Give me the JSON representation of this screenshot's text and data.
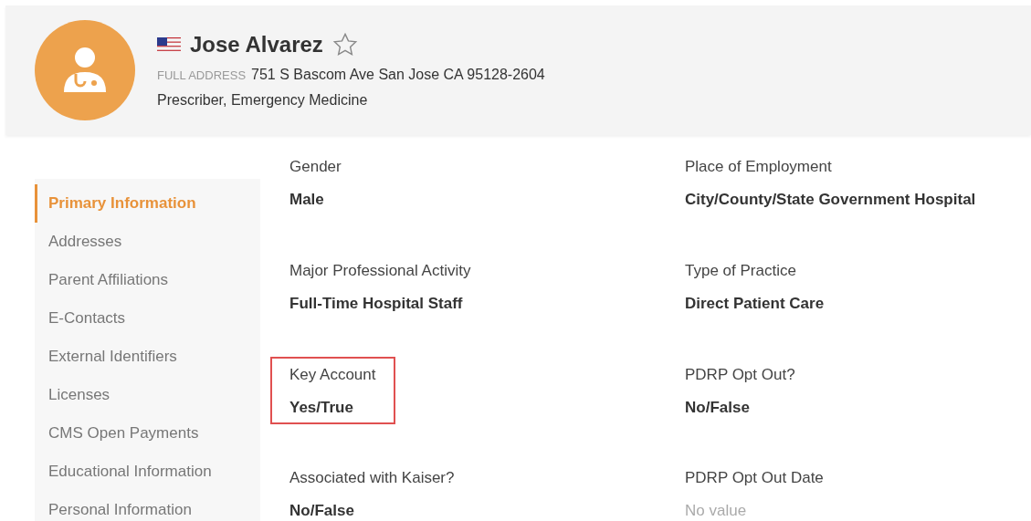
{
  "profile": {
    "name": "Jose Alvarez",
    "starred": false,
    "address_label": "FULL ADDRESS",
    "address": "751 S Bascom Ave San Jose CA 95128-2604",
    "role": "Prescriber, Emergency Medicine"
  },
  "sidebar": {
    "items": [
      {
        "label": "Primary Information",
        "selected": true
      },
      {
        "label": "Addresses",
        "selected": false
      },
      {
        "label": "Parent Affiliations",
        "selected": false
      },
      {
        "label": "E-Contacts",
        "selected": false
      },
      {
        "label": "External Identifiers",
        "selected": false
      },
      {
        "label": "Licenses",
        "selected": false
      },
      {
        "label": "CMS Open Payments",
        "selected": false
      },
      {
        "label": "Educational Information",
        "selected": false
      },
      {
        "label": "Personal Information",
        "selected": false
      }
    ]
  },
  "fields": [
    {
      "label": "Gender",
      "value": "Male",
      "highlighted": false,
      "empty": false
    },
    {
      "label": "Place of Employment",
      "value": "City/County/State Government Hospital",
      "highlighted": false,
      "empty": false
    },
    {
      "label": "Major Professional Activity",
      "value": "Full-Time Hospital Staff",
      "highlighted": false,
      "empty": false
    },
    {
      "label": "Type of Practice",
      "value": "Direct Patient Care",
      "highlighted": false,
      "empty": false
    },
    {
      "label": "Key Account",
      "value": "Yes/True",
      "highlighted": true,
      "empty": false
    },
    {
      "label": "PDRP Opt Out?",
      "value": "No/False",
      "highlighted": false,
      "empty": false
    },
    {
      "label": "Associated with Kaiser?",
      "value": "No/False",
      "highlighted": false,
      "empty": false
    },
    {
      "label": "PDRP Opt Out Date",
      "value": "No value",
      "highlighted": false,
      "empty": true
    }
  ]
}
